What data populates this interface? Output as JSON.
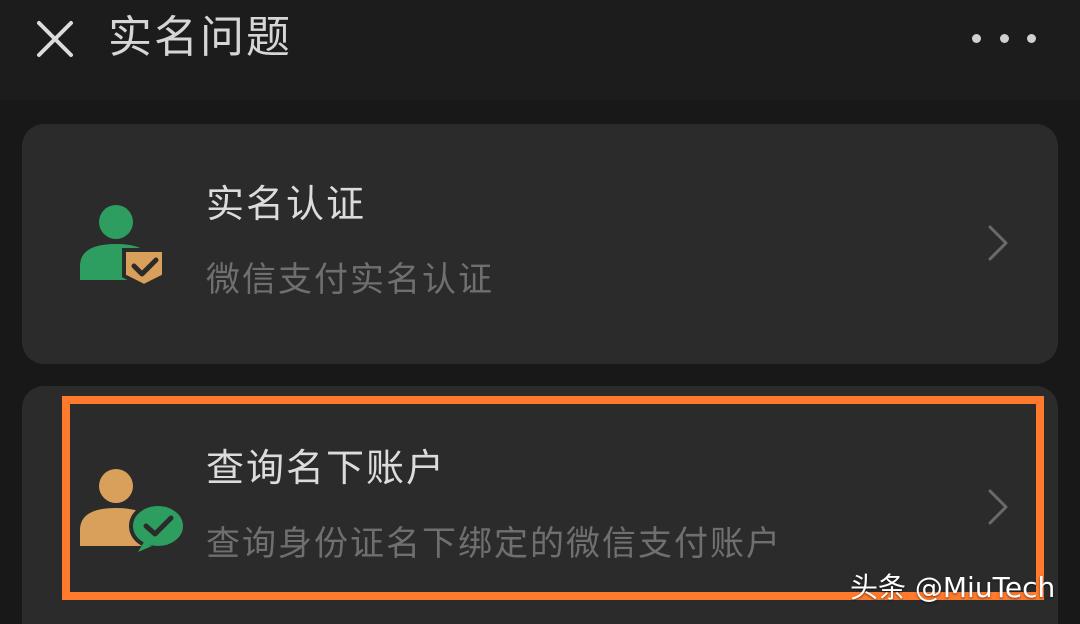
{
  "header": {
    "title": "实名问题",
    "close_icon": "close-icon",
    "more_icon": "more-dots-icon"
  },
  "items": [
    {
      "title": "实名认证",
      "subtitle": "微信支付实名认证",
      "icon": "user-verified-icon",
      "chevron_icon": "chevron-right-icon"
    },
    {
      "title": "查询名下账户",
      "subtitle": "查询身份证名下绑定的微信支付账户",
      "icon": "user-wechat-icon",
      "chevron_icon": "chevron-right-icon",
      "highlighted": true
    }
  ],
  "watermark": "头条 @MiuTech",
  "colors": {
    "background": "#191919",
    "card": "#2b2b2b",
    "title_text": "#dcdcdc",
    "subtitle_text": "#6f6f6f",
    "highlight_border": "#ff7a2d",
    "green": "#2e9e60",
    "tan": "#d9a05b"
  }
}
